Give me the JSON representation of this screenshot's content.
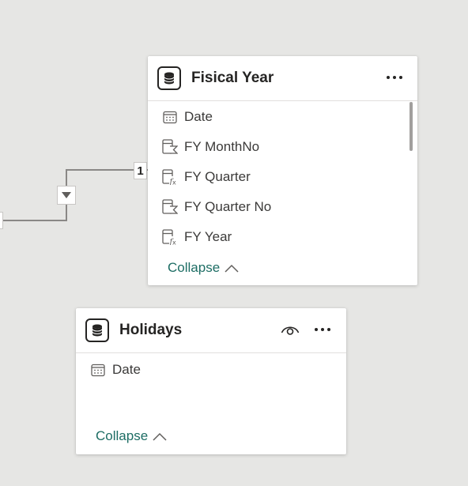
{
  "relationship": {
    "cardinality_label": "1",
    "cross_filter_icon": "triangle-down-icon"
  },
  "tables": [
    {
      "title": "Fisical Year",
      "icon": "database-icon",
      "fields": [
        {
          "label": "Date",
          "icon": "calendar-icon"
        },
        {
          "label": "FY MonthNo",
          "icon": "sum-column-icon"
        },
        {
          "label": "FY Quarter",
          "icon": "calculated-column-icon"
        },
        {
          "label": "FY Quarter No",
          "icon": "sum-column-icon"
        },
        {
          "label": "FY Year",
          "icon": "calculated-column-icon"
        }
      ],
      "collapse_label": "Collapse"
    },
    {
      "title": "Holidays",
      "icon": "database-icon",
      "fields": [
        {
          "label": "Date",
          "icon": "calendar-icon"
        }
      ],
      "collapse_label": "Collapse"
    }
  ],
  "colors": {
    "canvas": "#e6e6e4",
    "card": "#ffffff",
    "link": "#1d6d64",
    "line": "#8a8886"
  }
}
